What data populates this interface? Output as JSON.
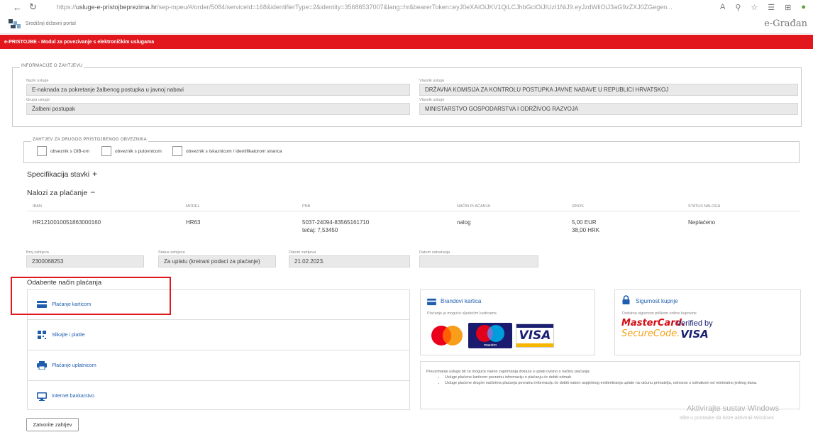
{
  "browser": {
    "url_prefix": "https://",
    "url_host": "usluge-e-pristojbeprezima.hr",
    "url_rest": "/sep-mpeu/#/order/5084/serviceId=168&identifierType=2&identity=35686537007&lang=hr&bearerToken=eyJ0eXAiOiJKV1QiLCJhbGciOiJIUzI1NiJ9.eyJzdWIiOiJ3aG9zZXJ0ZGegen..."
  },
  "portal": {
    "name": "Središnji državni portal",
    "brand": "e-Građan"
  },
  "header": {
    "title": "e-PRISTOJBE - Modul za povezivanje s elektroničkim uslugama"
  },
  "info": {
    "legend": "INFORMACIJE O ZAHTJEVU",
    "naziv_label": "Naziv usluge",
    "naziv_value": "E-naknada za pokretanje žalbenog postupka u javnoj nabavi",
    "grupa_label": "Grupa usluge",
    "grupa_value": "Žalbeni postupak",
    "vlasnik_label": "Vlasnik usluge",
    "vlasnik_value": "DRŽAVNA KOMISIJA ZA KONTROLU POSTUPKA JAVNE NABAVE U REPUBLICI HRVATSKOJ",
    "vlasnik2_label": "Vlasnik usluge",
    "vlasnik2_value": "MINISTARSTVO GOSPODARSTVA I ODRŽIVOG RAZVOJA"
  },
  "obveznik": {
    "legend": "ZAHTJEV ZA DRUGOG PRISTOJBENOG OBVEZNIKA",
    "options": [
      "obveznik s OIB-om",
      "obveznik s putovnicom",
      "obveznik s iskaznicom / identifikatorom stranca"
    ]
  },
  "specifikacija": {
    "title": "Specifikacija stavki",
    "symbol": "+"
  },
  "nalozi": {
    "title": "Nalozi za plaćanje",
    "symbol": "−",
    "columns": [
      "IBAN",
      "MODEL",
      "PNB",
      "NAČIN PLAĆANJA",
      "IZNOS",
      "STATUS NALOGA"
    ],
    "row": {
      "iban": "HR1210010051863000160",
      "model": "HR63",
      "pnb": "5037-24094-83565161710",
      "tecaj": "tečaj: 7,53450",
      "nacin": "nalog",
      "iznos_eur": "5,00 EUR",
      "iznos_hrk": "38,00 HRK",
      "status": "Neplaćeno"
    }
  },
  "zahtjev": {
    "broj_label": "Broj zahtjeva",
    "broj_value": "2300068253",
    "status_label": "Status zahtjeva",
    "status_value": "Za uplatu (kreirani podaci za plaćanje)",
    "datum_label": "Datum zahtjeva",
    "datum_value": "21.02.2023.",
    "zatv_label": "Datum zatvaranja",
    "zatv_value": ""
  },
  "payment": {
    "title": "Odaberite način plaćanja",
    "items": [
      "Plaćanje karticom",
      "Slikajte i platite",
      "Plaćanje uplatnicom",
      "Internet bankarstvo"
    ]
  },
  "brands": {
    "title": "Brandovi kartica",
    "subtitle": "Plaćanje je moguće sljedećim karticama",
    "visa": "VISA",
    "maestro": "maestro"
  },
  "security": {
    "title": "Sigurnost kupnje",
    "subtitle": "Dodatna sigurnost prilikom online kupovine",
    "mc_line1": "MasterCard.",
    "mc_line2": "SecureCode.",
    "verified": "Verified by",
    "visa": "VISA"
  },
  "note": {
    "intro": "Preuzimanje usluge bit će moguće nakon zaprimanja dokaza o uplati ovisno o načinu plaćanja:",
    "items": [
      "Usluge plaćene karticom povratnu informaciju o plaćanju će dobiti odmah.",
      "Usluge plaćene drugim načinima plaćanja povratnu informaciju će dobiti nakon uspješnog evidentiranja uplate na računu primatelja, odnosno s odmakom od minimalno jednog dana."
    ]
  },
  "close_button": "Zatvorite zahtjev",
  "watermark": {
    "line1": "Aktivirajte sustav Windows",
    "line2": "Idite u postavke da biste aktivirali Windows"
  },
  "colors": {
    "red": "#e2171e",
    "link": "#1f5eae",
    "field": "#e9e9e9"
  }
}
